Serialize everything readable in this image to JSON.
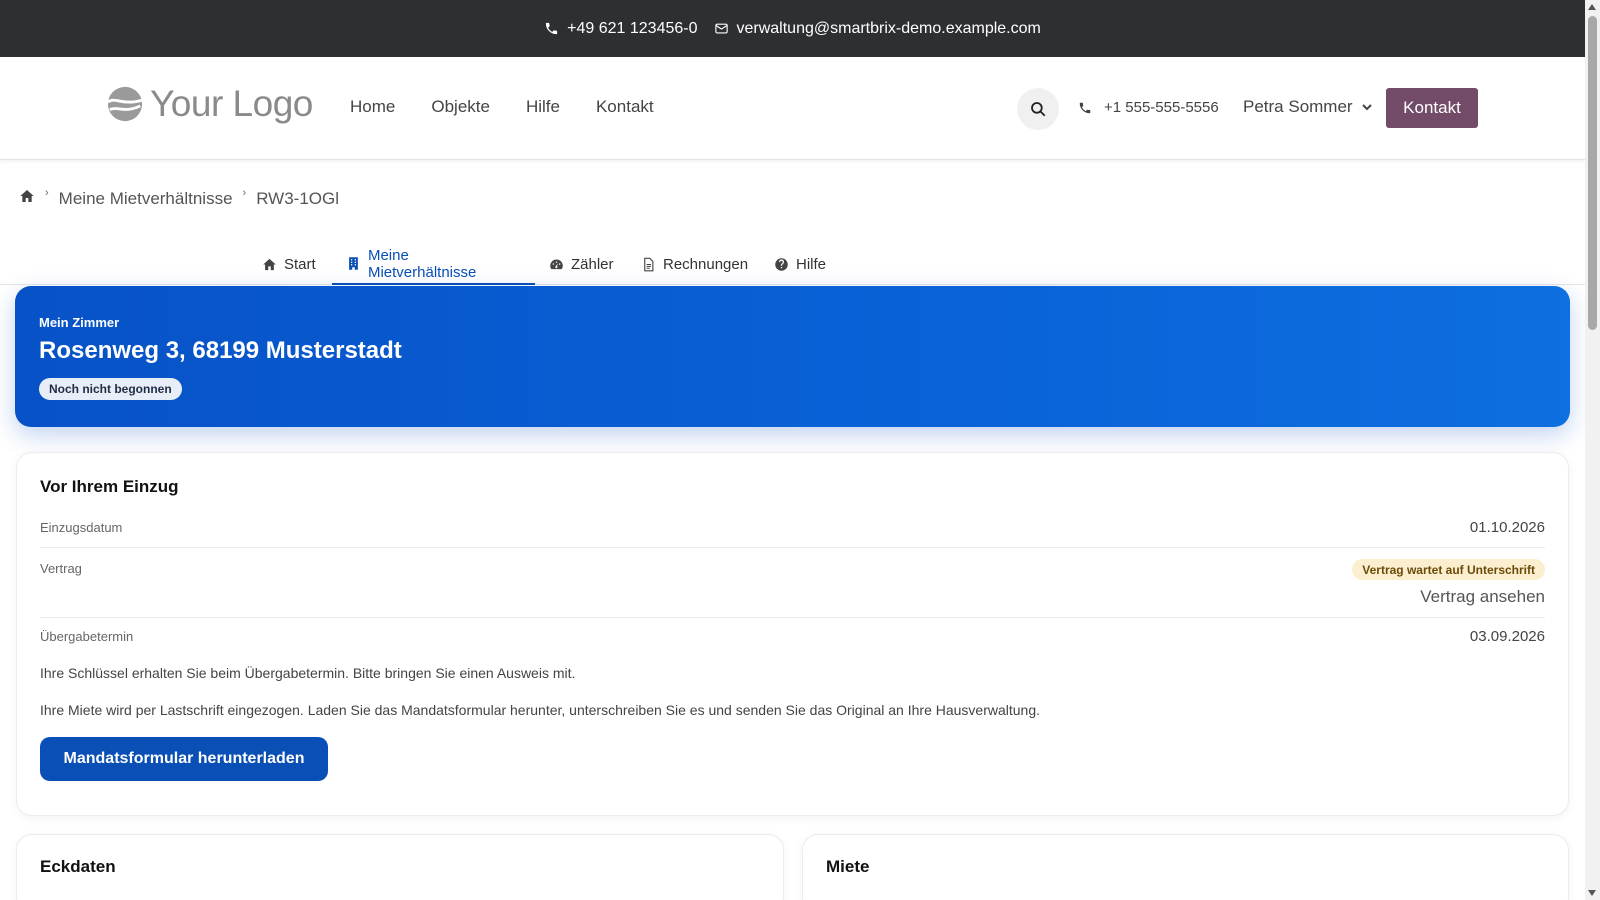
{
  "topbar": {
    "phone": "+49 621 123456-0",
    "email": "verwaltung@smartbrix-demo.example.com"
  },
  "header": {
    "logo_text": "Your Logo",
    "nav": [
      "Home",
      "Objekte",
      "Hilfe",
      "Kontakt"
    ],
    "phone": "+1 555-555-5556",
    "user_name": "Petra Sommer",
    "cta_label": "Kontakt"
  },
  "breadcrumb": {
    "items": [
      "Meine Mietverhältnisse",
      "RW3-1OGl"
    ]
  },
  "tabs": [
    {
      "label": "Start",
      "icon": "home-icon"
    },
    {
      "label": "Meine Mietverhältnisse",
      "icon": "building-icon",
      "active": true
    },
    {
      "label": "Zähler",
      "icon": "gauge-icon"
    },
    {
      "label": "Rechnungen",
      "icon": "document-icon"
    },
    {
      "label": "Hilfe",
      "icon": "question-icon"
    }
  ],
  "hero": {
    "kicker": "Mein Zimmer",
    "address": "Rosenweg 3, 68199 Musterstadt",
    "status": "Noch nicht begonnen"
  },
  "move_in_card": {
    "title": "Vor Ihrem Einzug",
    "rows": {
      "move_in_date_label": "Einzugsdatum",
      "move_in_date_value": "01.10.2026",
      "contract_label": "Vertrag",
      "contract_status": "Vertrag wartet auf Unterschrift",
      "contract_link": "Vertrag ansehen",
      "handover_label": "Übergabetermin",
      "handover_value": "03.09.2026"
    },
    "key_note": "Ihre Schlüssel erhalten Sie beim Übergabetermin. Bitte bringen Sie einen Ausweis mit.",
    "rent_note": "Ihre Miete wird per Lastschrift eingezogen. Laden Sie das Mandatsformular herunter, unterschreiben Sie es und senden Sie das Original an Ihre Hausverwaltung.",
    "download_button": "Mandatsformular herunterladen"
  },
  "bottom_cards": {
    "left_title": "Eckdaten",
    "right_title": "Miete"
  },
  "colors": {
    "topbar_bg": "#2d2f33",
    "brand_cta": "#714b67",
    "accent_blue": "#0a4fb5",
    "warning_badge_bg": "#fbefd0"
  }
}
